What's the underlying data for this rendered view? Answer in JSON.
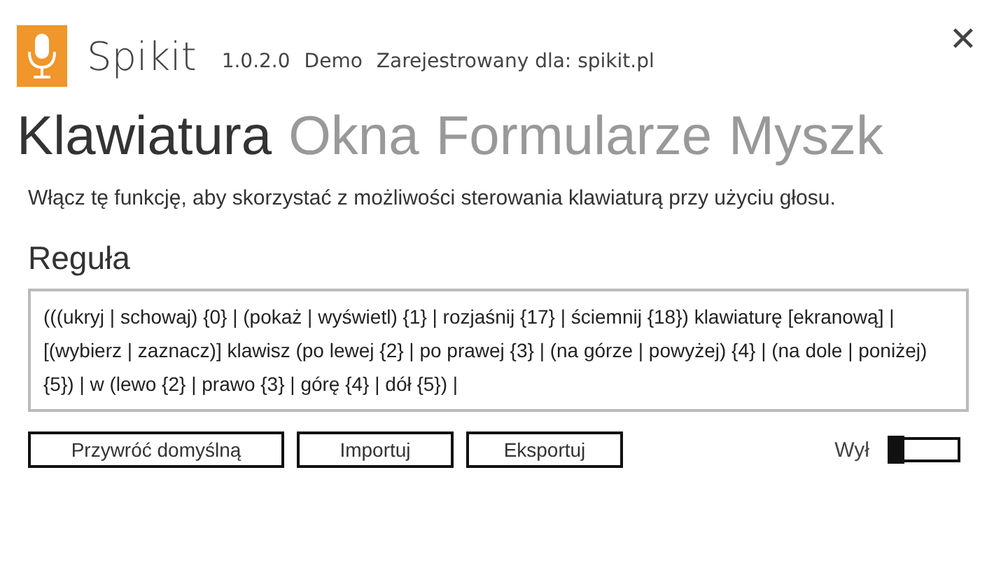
{
  "app": {
    "name": "Spikit",
    "version": "1.0.2.0",
    "edition": "Demo",
    "registration": "Zarejestrowany dla: spikit.pl",
    "close": "✕"
  },
  "tabs": [
    {
      "label": "Klawiatura",
      "selected": true
    },
    {
      "label": "Okna",
      "selected": false
    },
    {
      "label": "Formularze",
      "selected": false
    },
    {
      "label": "Myszk",
      "selected": false
    }
  ],
  "description": "Włącz tę funkcję, aby skorzystać z możliwości sterowania klawiaturą przy użyciu głosu.",
  "rule": {
    "label": "Reguła",
    "value": "(((ukryj | schowaj) {0} | (pokaż | wyświetl) {1} | rozjaśnij {17} | ściemnij {18}) klawiaturę [ekranową] | [(wybierz | zaznacz)] klawisz (po lewej {2} | po prawej {3} | (na górze | powyżej) {4} | (na dole | poniżej) {5}) | w (lewo {2} | prawo {3} | górę {4} | dół {5}) |"
  },
  "buttons": [
    "Przywróć domyślną",
    "Importuj",
    "Eksportuj"
  ],
  "toggle": {
    "label": "Wył",
    "on": false
  }
}
